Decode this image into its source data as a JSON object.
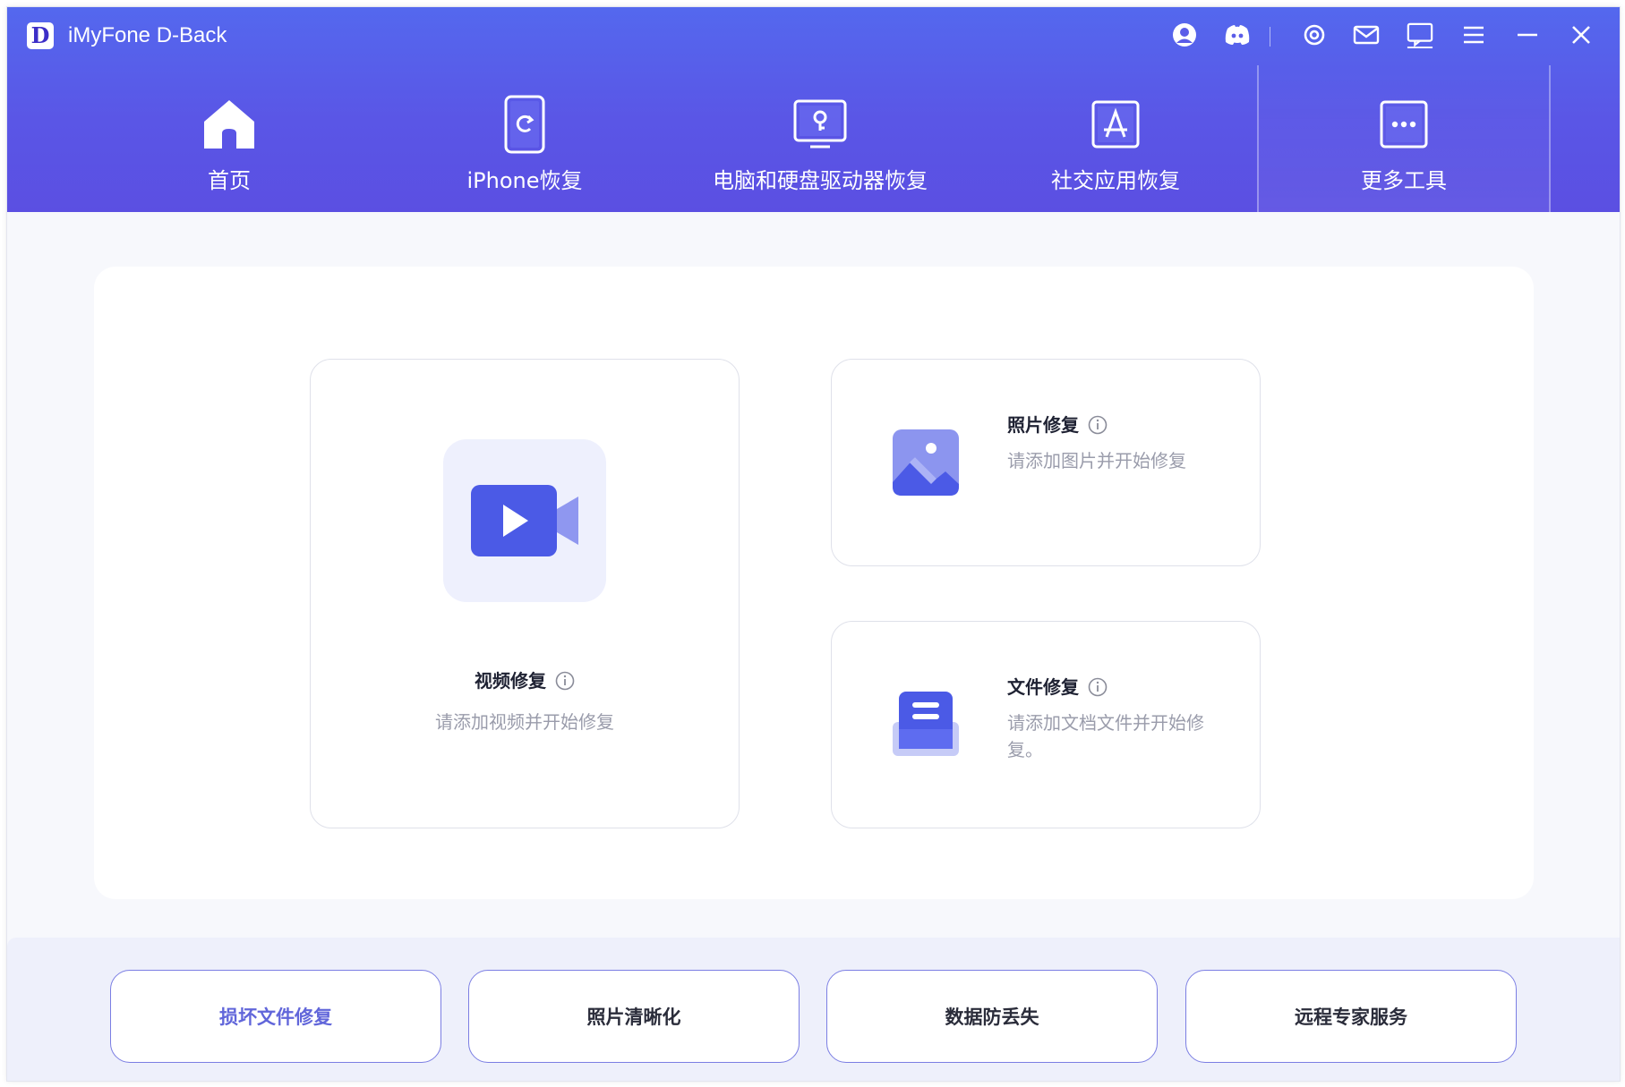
{
  "app": {
    "title": "iMyFone D-Back",
    "logo_letter": "D"
  },
  "titlebar_icons": [
    "account-icon",
    "discord-icon",
    "settings-icon",
    "mail-icon",
    "feedback-icon",
    "menu-icon",
    "minimize-icon",
    "close-icon"
  ],
  "nav": {
    "tabs": [
      {
        "label": "首页",
        "icon": "home-icon"
      },
      {
        "label": "iPhone恢复",
        "icon": "iphone-restore-icon"
      },
      {
        "label": "电脑和硬盘驱动器恢复",
        "icon": "computer-drive-icon"
      },
      {
        "label": "社交应用恢复",
        "icon": "app-store-icon"
      },
      {
        "label": "更多工具",
        "icon": "more-tools-icon",
        "active": true
      }
    ]
  },
  "cards": {
    "video": {
      "title": "视频修复",
      "subtitle": "请添加视频并开始修复",
      "icon": "video-camera-icon"
    },
    "photo": {
      "title": "照片修复",
      "subtitle": "请添加图片并开始修复",
      "icon": "photo-icon"
    },
    "file": {
      "title": "文件修复",
      "subtitle": "请添加文档文件并开始修复。",
      "icon": "document-icon"
    }
  },
  "bottom_buttons": [
    {
      "label": "损坏文件修复",
      "highlight": true
    },
    {
      "label": "照片清晰化"
    },
    {
      "label": "数据防丢失"
    },
    {
      "label": "远程专家服务"
    }
  ],
  "colors": {
    "header_start": "#5468ee",
    "header_end": "#5b4fe2",
    "accent": "#6166da",
    "icon_blue": "#4b5ae6"
  }
}
